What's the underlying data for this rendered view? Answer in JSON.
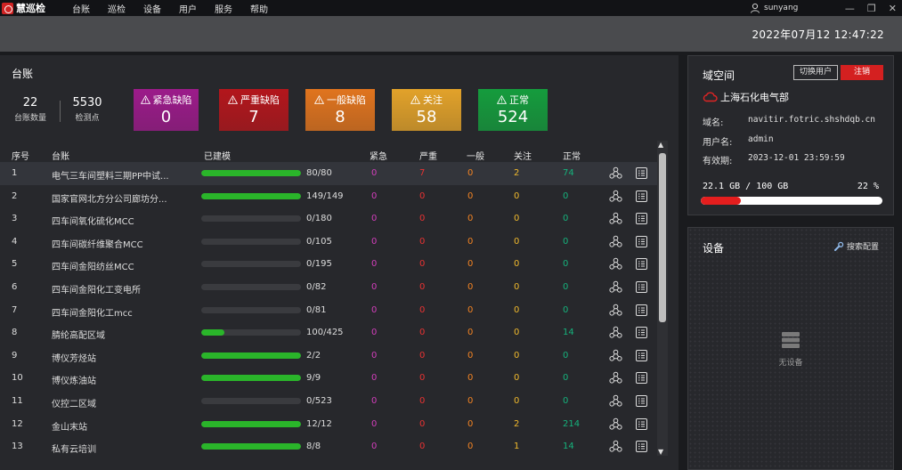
{
  "app": {
    "name": "慧巡检"
  },
  "menu": [
    "台账",
    "巡检",
    "设备",
    "用户",
    "服务",
    "帮助"
  ],
  "user": {
    "name": "sunyang"
  },
  "datetime": "2022年07月12 12:47:22",
  "ledger": {
    "title": "台账",
    "count_value": "22",
    "count_label": "台账数量",
    "points_value": "5530",
    "points_label": "检测点"
  },
  "cards": [
    {
      "label": "紧急缺陷",
      "value": "0",
      "color": "#9c1b8a"
    },
    {
      "label": "严重缺陷",
      "value": "7",
      "color": "#b3161c"
    },
    {
      "label": "一般缺陷",
      "value": "8",
      "color": "#e0741e"
    },
    {
      "label": "关注",
      "value": "58",
      "color": "#e2a22a"
    },
    {
      "label": "正常",
      "value": "524",
      "color": "#159c3d"
    }
  ],
  "table": {
    "headers": [
      "序号",
      "台账",
      "已建模",
      "紧急",
      "严重",
      "一般",
      "关注",
      "正常"
    ],
    "rows": [
      {
        "idx": "1",
        "name": "电气三车间塑料三期PP中试...",
        "progress_text": "80/80",
        "progress": 1.0,
        "urgent": "0",
        "severe": "7",
        "general": "0",
        "attention": "2",
        "normal": "74"
      },
      {
        "idx": "2",
        "name": "国家官网北方分公司廊坊分...",
        "progress_text": "149/149",
        "progress": 1.0,
        "urgent": "0",
        "severe": "0",
        "general": "0",
        "attention": "0",
        "normal": "0"
      },
      {
        "idx": "3",
        "name": "四车间氧化硫化MCC",
        "progress_text": "0/180",
        "progress": 0,
        "urgent": "0",
        "severe": "0",
        "general": "0",
        "attention": "0",
        "normal": "0"
      },
      {
        "idx": "4",
        "name": "四车间碳纤维聚合MCC",
        "progress_text": "0/105",
        "progress": 0,
        "urgent": "0",
        "severe": "0",
        "general": "0",
        "attention": "0",
        "normal": "0"
      },
      {
        "idx": "5",
        "name": "四车间金阳纺丝MCC",
        "progress_text": "0/195",
        "progress": 0,
        "urgent": "0",
        "severe": "0",
        "general": "0",
        "attention": "0",
        "normal": "0"
      },
      {
        "idx": "6",
        "name": "四车间金阳化工变电所",
        "progress_text": "0/82",
        "progress": 0,
        "urgent": "0",
        "severe": "0",
        "general": "0",
        "attention": "0",
        "normal": "0"
      },
      {
        "idx": "7",
        "name": "四车间金阳化工mcc",
        "progress_text": "0/81",
        "progress": 0,
        "urgent": "0",
        "severe": "0",
        "general": "0",
        "attention": "0",
        "normal": "0"
      },
      {
        "idx": "8",
        "name": "腈纶高配区域",
        "progress_text": "100/425",
        "progress": 0.235,
        "urgent": "0",
        "severe": "0",
        "general": "0",
        "attention": "0",
        "normal": "14"
      },
      {
        "idx": "9",
        "name": "博仪芳烃站",
        "progress_text": "2/2",
        "progress": 1.0,
        "urgent": "0",
        "severe": "0",
        "general": "0",
        "attention": "0",
        "normal": "0"
      },
      {
        "idx": "10",
        "name": "博仪炼油站",
        "progress_text": "9/9",
        "progress": 1.0,
        "urgent": "0",
        "severe": "0",
        "general": "0",
        "attention": "0",
        "normal": "0"
      },
      {
        "idx": "11",
        "name": "仪控二区域",
        "progress_text": "0/523",
        "progress": 0,
        "urgent": "0",
        "severe": "0",
        "general": "0",
        "attention": "0",
        "normal": "0"
      },
      {
        "idx": "12",
        "name": "金山末站",
        "progress_text": "12/12",
        "progress": 1.0,
        "urgent": "0",
        "severe": "0",
        "general": "0",
        "attention": "2",
        "normal": "214"
      },
      {
        "idx": "13",
        "name": "私有云培训",
        "progress_text": "8/8",
        "progress": 1.0,
        "urgent": "0",
        "severe": "0",
        "general": "0",
        "attention": "1",
        "normal": "14"
      }
    ]
  },
  "domain_space": {
    "title": "域空间",
    "switch_user": "切换用户",
    "logout": "注销",
    "org": "上海石化电气部",
    "domain_label": "域名:",
    "domain_value": "navitir.fotric.shshdqb.cn",
    "username_label": "用户名:",
    "username_value": "admin",
    "expiry_label": "有效期:",
    "expiry_value": "2023-12-01 23:59:59",
    "storage_text": "22.1 GB / 100 GB",
    "storage_percent_text": "22 %",
    "storage_fraction": 0.22
  },
  "devices": {
    "title": "设备",
    "search_config": "搜索配置",
    "empty_text": "无设备"
  }
}
